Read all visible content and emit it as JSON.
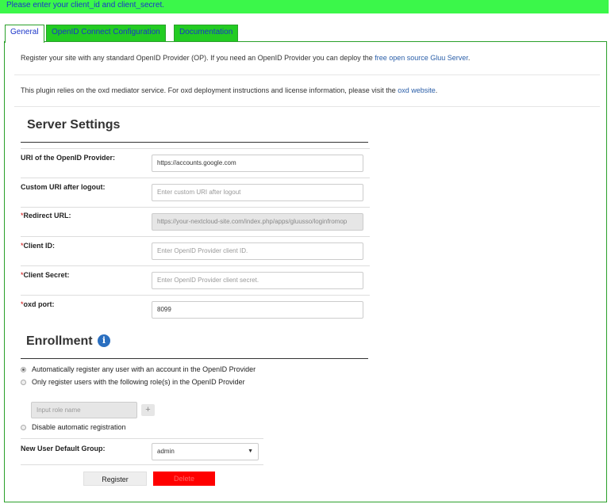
{
  "notice": "Please enter your client_id and client_secret.",
  "tabs": [
    "General",
    "OpenID Connect Configuration",
    "Documentation"
  ],
  "info1": {
    "text": "Register your site with any standard OpenID Provider (OP). If you need an OpenID Provider you can deploy the ",
    "link": "free open source Gluu Server",
    "end": "."
  },
  "info2": {
    "text": "This plugin relies on the oxd mediator service. For oxd deployment instructions and license information, please visit the ",
    "link": "oxd website",
    "end": "."
  },
  "server_settings": {
    "title": "Server Settings",
    "fields": [
      {
        "label": "URI of the OpenID Provider:",
        "required": "",
        "value": "https://accounts.google.com",
        "placeholder": ""
      },
      {
        "label": "Custom URI after logout:",
        "required": "",
        "value": "",
        "placeholder": "Enter custom URI after logout"
      },
      {
        "label": "Redirect URL:",
        "required": "*",
        "value": "https://your-nextcloud-site.com/index.php/apps/gluusso/loginfromop",
        "placeholder": ""
      },
      {
        "label": "Client ID:",
        "required": "*",
        "value": "",
        "placeholder": "Enter OpenID Provider client ID."
      },
      {
        "label": "Client Secret:",
        "required": "*",
        "value": "",
        "placeholder": "Enter OpenID Provider client secret."
      },
      {
        "label": "oxd port:",
        "required": "*",
        "value": "8099",
        "placeholder": ""
      }
    ]
  },
  "enrollment": {
    "title": "Enrollment",
    "options": [
      "Automatically register any user with an account in the OpenID Provider",
      "Only register users with the following role(s) in the OpenID Provider"
    ],
    "selected": 0,
    "role_placeholder": "Input role name",
    "add_symbol": "+",
    "disable_label": "Disable automatic registration",
    "default_group_label": "New User Default Group:",
    "default_group_value": "admin"
  },
  "buttons": {
    "register": "Register",
    "delete": "Delete"
  },
  "colors": {
    "notice_bg": "#3bf74a",
    "tab_bg": "#22cc22",
    "link": "#2a5ea8",
    "delete_bg": "#ff0000"
  }
}
